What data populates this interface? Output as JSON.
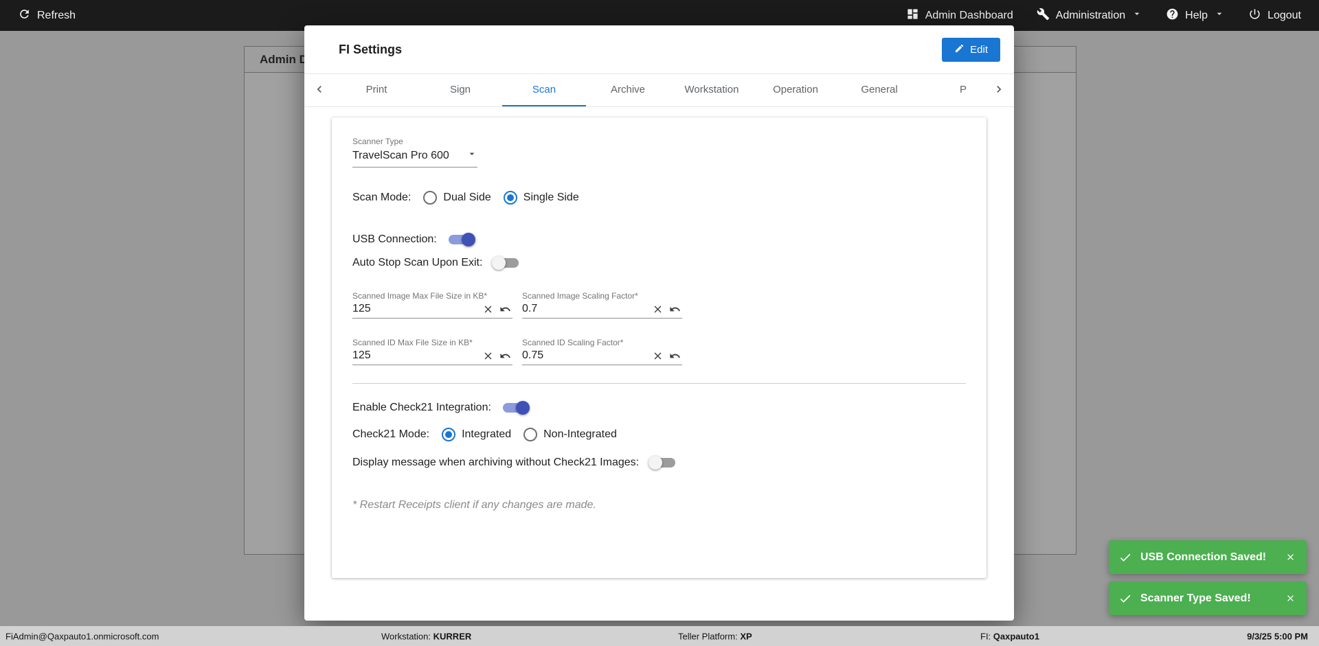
{
  "colors": {
    "accent": "#1976d2",
    "toast_green": "#4caf50",
    "toggle_on": "#3f51b5"
  },
  "topbar": {
    "refresh": "Refresh",
    "admin_dashboard": "Admin Dashboard",
    "administration": "Administration",
    "help": "Help",
    "logout": "Logout"
  },
  "background": {
    "page_title": "Admin D"
  },
  "modal": {
    "title": "FI Settings",
    "edit": "Edit",
    "active_tab": "Scan",
    "tabs": [
      "Print",
      "Sign",
      "Scan",
      "Archive",
      "Workstation",
      "Operation",
      "General",
      "P"
    ],
    "form": {
      "scanner_type_label": "Scanner Type",
      "scanner_type_value": "TravelScan Pro 600",
      "scan_mode_label": "Scan Mode:",
      "scan_mode_options": [
        "Dual Side",
        "Single Side"
      ],
      "scan_mode_selected": "Single Side",
      "usb_label": "USB Connection:",
      "usb_on": true,
      "auto_stop_label": "Auto Stop Scan Upon Exit:",
      "auto_stop_on": false,
      "fields": [
        {
          "label": "Scanned Image Max File Size in KB*",
          "value": "125"
        },
        {
          "label": "Scanned Image Scaling Factor*",
          "value": "0.7"
        },
        {
          "label": "Scanned ID Max File Size in KB*",
          "value": "125"
        },
        {
          "label": "Scanned ID Scaling Factor*",
          "value": "0.75"
        }
      ],
      "check21_label": "Enable Check21 Integration:",
      "check21_on": true,
      "check21_mode_label": "Check21 Mode:",
      "check21_mode_options": [
        "Integrated",
        "Non-Integrated"
      ],
      "check21_mode_selected": "Integrated",
      "display_msg_label": "Display message when archiving without Check21 Images:",
      "display_msg_on": false,
      "note": "* Restart Receipts client if any changes are made."
    }
  },
  "toasts": [
    {
      "message": "USB Connection Saved!"
    },
    {
      "message": "Scanner Type Saved!"
    }
  ],
  "statusbar": {
    "user": "FiAdmin@Qaxpauto1.onmicrosoft.com",
    "workstation_label": "Workstation:",
    "workstation": "KURRER",
    "platform_label": "Teller Platform:",
    "platform": "XP",
    "fi_label": "FI:",
    "fi": "Qaxpauto1",
    "datetime": "9/3/25 5:00 PM"
  }
}
